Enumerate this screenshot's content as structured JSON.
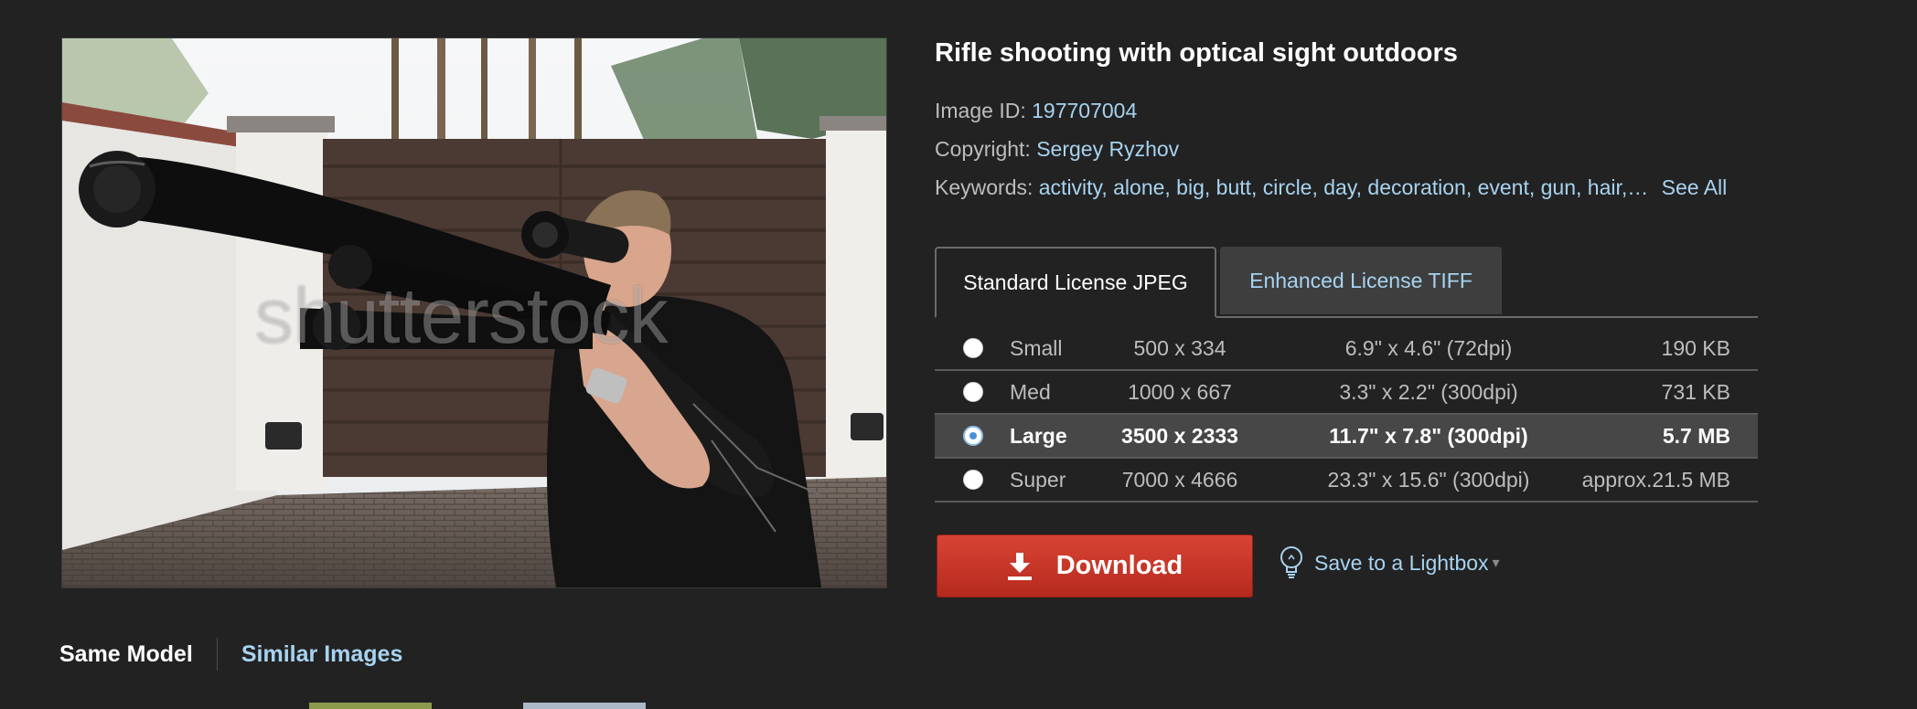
{
  "image": {
    "alt": "Man aiming a rifle with optical sight",
    "watermark": "shutterstock"
  },
  "details": {
    "title": "Rifle shooting with optical sight outdoors",
    "image_id_label": "Image ID:",
    "image_id": "197707004",
    "copyright_label": "Copyright:",
    "copyright": "Sergey Ryzhov",
    "keywords_label": "Keywords:",
    "keywords": "activity, alone, big, butt, circle, day, decoration, event, gun, hair,…",
    "see_all": "See All"
  },
  "license_tabs": [
    {
      "label": "Standard License JPEG",
      "active": true
    },
    {
      "label": "Enhanced License TIFF",
      "active": false
    }
  ],
  "sizes": [
    {
      "name": "Small",
      "pixels": "500 x 334",
      "inches": "6.9\" x 4.6\"  (72dpi)",
      "file_size": "190 KB",
      "selected": false
    },
    {
      "name": "Med",
      "pixels": "1000 x 667",
      "inches": "3.3\" x 2.2\"  (300dpi)",
      "file_size": "731 KB",
      "selected": false
    },
    {
      "name": "Large",
      "pixels": "3500 x 2333",
      "inches": "11.7\" x 7.8\"  (300dpi)",
      "file_size": "5.7 MB",
      "selected": true
    },
    {
      "name": "Super",
      "pixels": "7000 x 4666",
      "inches": "23.3\" x 15.6\"  (300dpi)",
      "file_size": "approx.21.5 MB",
      "selected": false
    }
  ],
  "actions": {
    "download": "Download",
    "lightbox": "Save to a Lightbox",
    "lightbox_caret": "▾"
  },
  "bottom_tabs": {
    "active": "Same Model",
    "other": "Similar Images"
  },
  "colors": {
    "background": "#222222",
    "link": "#a7d3f0",
    "download": "#c8352a"
  }
}
